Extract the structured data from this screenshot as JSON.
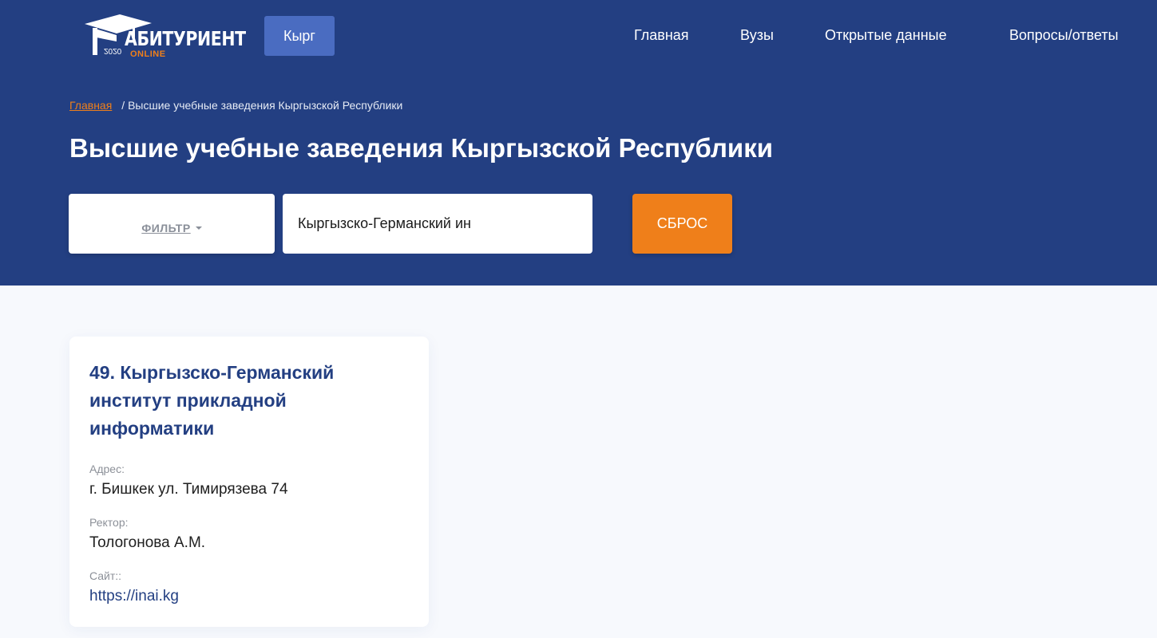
{
  "header": {
    "logo": {
      "text": "АБИТУРИЕНТ",
      "sub": "ONLINE",
      "year": "2020",
      "icon": "graduation-cap-icon"
    },
    "lang_button": "Кырг",
    "nav": [
      "Главная",
      "Вузы",
      "Открытые данные",
      "Вопросы/ответы"
    ]
  },
  "breadcrumb": {
    "home": "Главная",
    "current": "/ Высшие учебные заведения Кыргызской Республики"
  },
  "page_title": "Высшие учебные заведения Кыргызской Республики",
  "filters": {
    "filter_label": "ФИЛЬТР",
    "search_value": "Кыргызско-Германский ин",
    "reset_label": "СБРОС"
  },
  "card": {
    "title": "49. Кыргызско-Германский институт прикладной информатики",
    "address_label": "Адрес:",
    "address": "г. Бишкек ул. Тимирязева 74",
    "rector_label": "Ректор:",
    "rector": "Тологонова А.М.",
    "site_label": "Сайт::",
    "site": "https://inai.kg"
  },
  "colors": {
    "hero_bg": "#233f82",
    "accent_orange": "#ef7f1a",
    "lang_button_bg": "#4a6cc1",
    "page_bg": "#f7f9fd"
  }
}
